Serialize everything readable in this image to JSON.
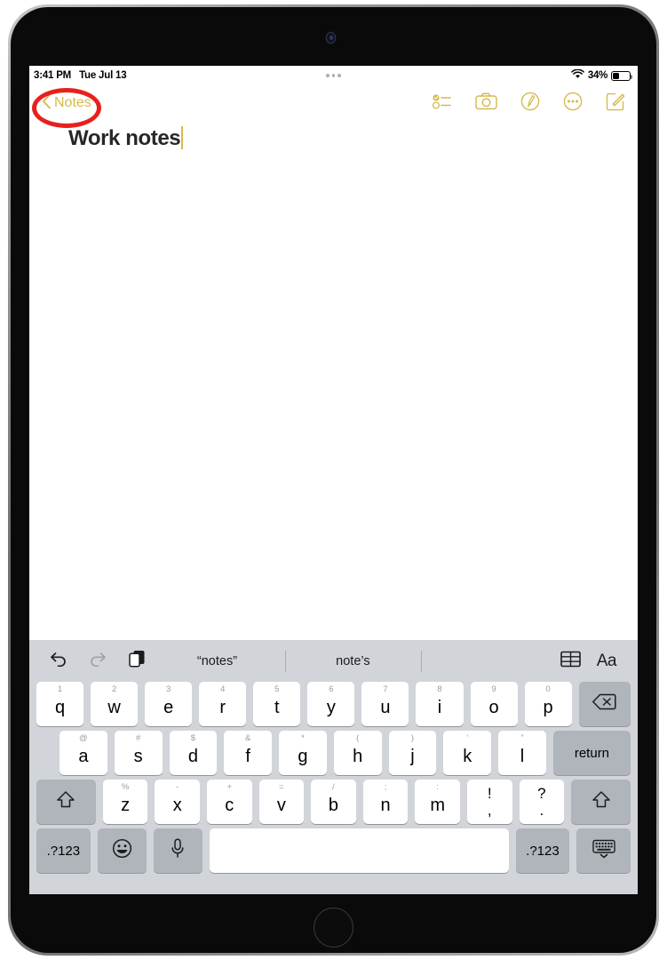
{
  "device": {
    "name": "ipad",
    "camera_icon": "front-camera",
    "home_button_icon": "home-button"
  },
  "status_bar": {
    "time": "3:41 PM",
    "date": "Tue Jul 13",
    "multitask_indicator": "multitask-dots",
    "wifi_icon": "wifi-icon",
    "battery_percent": "34%",
    "battery_level": 34,
    "battery_icon": "battery-icon"
  },
  "toolbar": {
    "back_label": "Notes",
    "back_icon": "chevron-left-icon",
    "accent_color": "#d6b94b",
    "actions": [
      {
        "name": "checklist-icon",
        "label": "Checklist"
      },
      {
        "name": "camera-icon",
        "label": "Camera"
      },
      {
        "name": "markup-icon",
        "label": "Markup"
      },
      {
        "name": "more-icon",
        "label": "More"
      },
      {
        "name": "compose-icon",
        "label": "Compose"
      }
    ]
  },
  "annotation": {
    "shape": "ellipse",
    "color": "#e8201c",
    "target": "back-button"
  },
  "note": {
    "title": "Work notes",
    "caret_color": "#d6b94b"
  },
  "keyboard": {
    "background_color": "#d1d4d9",
    "predictive": {
      "undo_icon": "undo-icon",
      "redo_icon": "redo-icon",
      "paste_icon": "paste-icon",
      "suggestions": [
        "“notes”",
        "note’s",
        ""
      ],
      "table_icon": "table-icon",
      "format_label": "Aa"
    },
    "rows": [
      {
        "name": "row-qwerty",
        "keys": [
          {
            "main": "q",
            "alt": "1"
          },
          {
            "main": "w",
            "alt": "2"
          },
          {
            "main": "e",
            "alt": "3"
          },
          {
            "main": "r",
            "alt": "4"
          },
          {
            "main": "t",
            "alt": "5"
          },
          {
            "main": "y",
            "alt": "6"
          },
          {
            "main": "u",
            "alt": "7"
          },
          {
            "main": "i",
            "alt": "8"
          },
          {
            "main": "o",
            "alt": "9"
          },
          {
            "main": "p",
            "alt": "0"
          },
          {
            "main": "",
            "alt": "",
            "icon": "backspace-icon",
            "style": "dark",
            "width": "wide-11"
          }
        ]
      },
      {
        "name": "row-home",
        "keys": [
          {
            "main": "a",
            "alt": "@"
          },
          {
            "main": "s",
            "alt": "#"
          },
          {
            "main": "d",
            "alt": "$"
          },
          {
            "main": "f",
            "alt": "&"
          },
          {
            "main": "g",
            "alt": "*"
          },
          {
            "main": "h",
            "alt": "("
          },
          {
            "main": "j",
            "alt": ")"
          },
          {
            "main": "k",
            "alt": "’"
          },
          {
            "main": "l",
            "alt": "”"
          },
          {
            "main": "return",
            "alt": "",
            "style": "dark",
            "width": "wide-16"
          }
        ]
      },
      {
        "name": "row-shift",
        "keys": [
          {
            "main": "",
            "alt": "",
            "icon": "shift-icon",
            "style": "dark",
            "width": "wide-13"
          },
          {
            "main": "z",
            "alt": "%"
          },
          {
            "main": "x",
            "alt": "-"
          },
          {
            "main": "c",
            "alt": "+"
          },
          {
            "main": "v",
            "alt": "="
          },
          {
            "main": "b",
            "alt": "/"
          },
          {
            "main": "n",
            "alt": ";"
          },
          {
            "main": "m",
            "alt": ":"
          },
          {
            "main": "!",
            "sub": ",",
            "alt": "",
            "style": "punct"
          },
          {
            "main": "?",
            "sub": ".",
            "alt": "",
            "style": "punct"
          },
          {
            "main": "",
            "alt": "",
            "icon": "shift-icon",
            "style": "dark",
            "width": "wide-13"
          }
        ]
      },
      {
        "name": "row-bottom",
        "keys": [
          {
            "main": ".?123",
            "alt": "",
            "style": "dark",
            "width": "wide-11"
          },
          {
            "main": "",
            "alt": "",
            "icon": "emoji-icon",
            "style": "dark"
          },
          {
            "main": "",
            "alt": "",
            "icon": "microphone-icon",
            "style": "dark"
          },
          {
            "main": "",
            "alt": "",
            "style": "space",
            "width": "space"
          },
          {
            "main": ".?123",
            "alt": "",
            "style": "dark",
            "width": "wide-11"
          },
          {
            "main": "",
            "alt": "",
            "icon": "dismiss-keyboard-icon",
            "style": "dark",
            "width": "wide-11"
          }
        ]
      }
    ]
  }
}
